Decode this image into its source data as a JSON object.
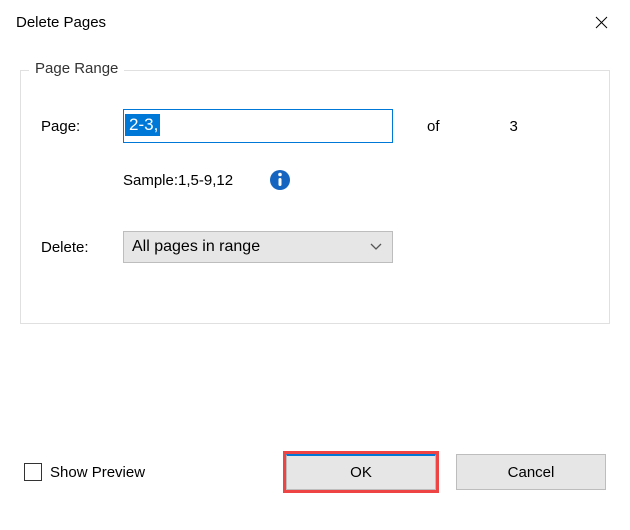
{
  "window": {
    "title": "Delete Pages"
  },
  "fieldset": {
    "legend": "Page Range",
    "pageLabel": "Page:",
    "pageValue": "2-3,",
    "ofLabel": "of",
    "totalPages": "3",
    "sampleText": "Sample:1,5-9,12",
    "deleteLabel": "Delete:",
    "deleteSelected": "All pages in range"
  },
  "footer": {
    "showPreviewLabel": "Show Preview",
    "okLabel": "OK",
    "cancelLabel": "Cancel"
  }
}
